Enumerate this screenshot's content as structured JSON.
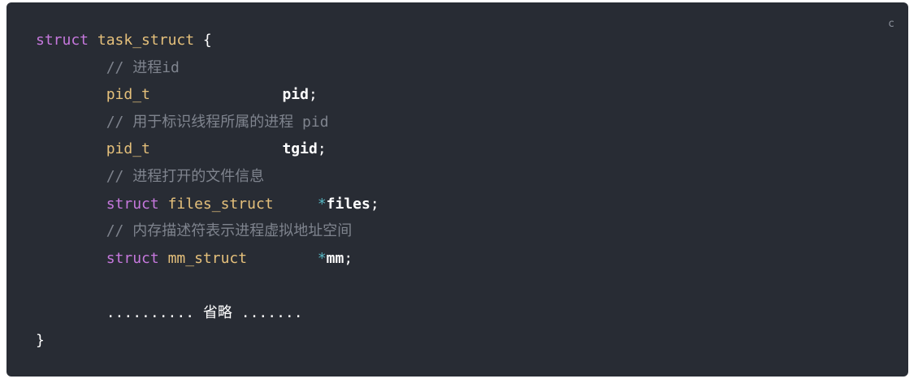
{
  "code_block": {
    "language_label": "c",
    "lines": {
      "l1": {
        "kw": "struct",
        "type": "task_struct",
        "rest": " {"
      },
      "l2": {
        "comment": "// 进程id"
      },
      "l3": {
        "type": "pid_t",
        "field": "pid",
        "end": ";"
      },
      "l4": {
        "comment": "// 用于标识线程所属的进程 pid"
      },
      "l5": {
        "type": "pid_t",
        "field": "tgid",
        "end": ";"
      },
      "l6": {
        "comment": "// 进程打开的文件信息"
      },
      "l7": {
        "kw": "struct",
        "type": "files_struct",
        "ptr": "*",
        "field": "files",
        "end": ";"
      },
      "l8": {
        "comment": "// 内存描述符表示进程虚拟地址空间"
      },
      "l9": {
        "kw": "struct",
        "type": "mm_struct",
        "ptr": "*",
        "field": "mm",
        "end": ";"
      },
      "l11": {
        "text": ".......... 省略 ......."
      },
      "l12": {
        "text": "}"
      }
    },
    "colors": {
      "background": "#282c34",
      "keyword": "#c678dd",
      "type": "#e5c07b",
      "comment": "#7f848e",
      "operator": "#56b6c2",
      "plain": "#ffffff"
    }
  }
}
